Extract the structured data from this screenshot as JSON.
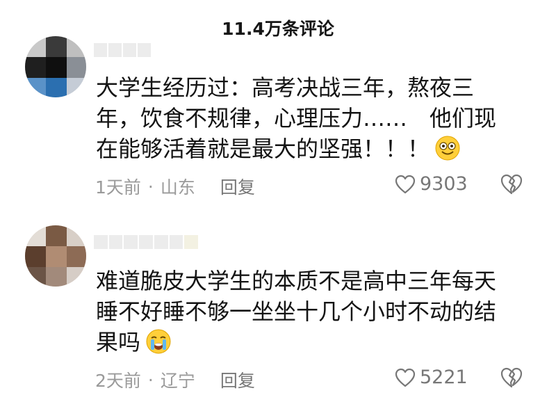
{
  "header": {
    "comment_count": "11.4万条评论"
  },
  "comments": [
    {
      "text": "大学生经历过：高考决战三年，熬夜三年，饮食不规律，心理压力……　他们现在能够活着就是最大的坚强！！！",
      "emoji": "smiling-face-emoji",
      "time": "1天前",
      "location": "山东",
      "reply_label": "回复",
      "likes": "9303"
    },
    {
      "text": "难道脆皮大学生的本质不是高中三年每天睡不好睡不够一坐坐十几个小时不动的结果吗",
      "emoji": "crying-face-emoji",
      "time": "2天前",
      "location": "辽宁",
      "reply_label": "回复",
      "likes": "5221"
    }
  ],
  "meta_separator": "·",
  "icons": {
    "like": "heart-outline-icon",
    "dislike": "broken-heart-icon"
  }
}
